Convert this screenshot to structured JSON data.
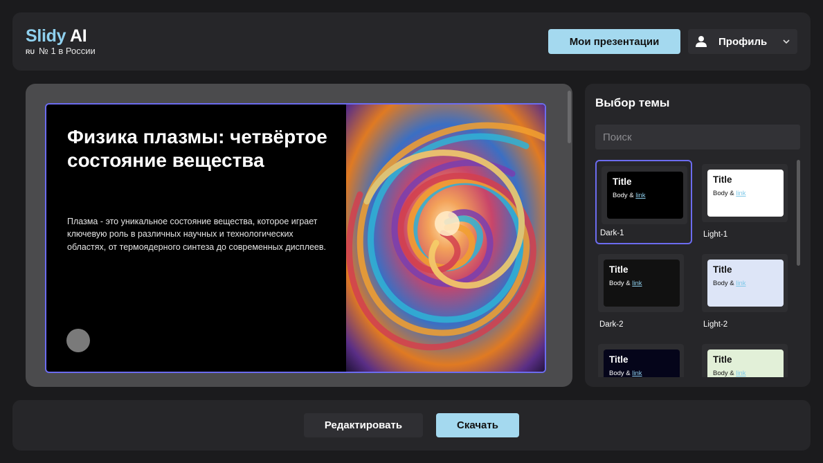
{
  "header": {
    "brand_name": "Slidy",
    "brand_suffix": "AI",
    "lang_badge": "RU",
    "tagline": "№ 1 в России",
    "my_presentations_label": "Мои презентации",
    "profile_label": "Профиль",
    "profile_icon": "user-icon",
    "dropdown_icon": "chevron-down-icon"
  },
  "slide": {
    "title": "Физика плазмы: четвёртое состояние вещества",
    "body": "Плазма - это уникальное состояние вещества, которое играет ключевую роль в различных научных и технологических областях, от термоядерного синтеза до современных дисплеев.",
    "image": "colorful-plasma-swirl-image"
  },
  "theme_panel": {
    "title": "Выбор темы",
    "search_placeholder": "Поиск",
    "themes": [
      {
        "name": "Dark-1",
        "title": "Title",
        "body": "Body &",
        "link": "link",
        "bg": "#000000",
        "fg": "#ffffff",
        "link_color": "#8fd0ee",
        "selected": true
      },
      {
        "name": "Light-1",
        "title": "Title",
        "body": "Body &",
        "link": "link",
        "bg": "#ffffff",
        "fg": "#111111",
        "link_color": "#7ec8e8",
        "selected": false
      },
      {
        "name": "Dark-2",
        "title": "Title",
        "body": "Body &",
        "link": "link",
        "bg": "#111111",
        "fg": "#ffffff",
        "link_color": "#8fd0ee",
        "selected": false
      },
      {
        "name": "Light-2",
        "title": "Title",
        "body": "Body &",
        "link": "link",
        "bg": "#dde5f7",
        "fg": "#111111",
        "link_color": "#7ec8e8",
        "selected": false
      },
      {
        "name": "",
        "title": "Title",
        "body": "Body &",
        "link": "link",
        "bg": "#05051a",
        "fg": "#ffffff",
        "link_color": "#8fd0ee",
        "selected": false
      },
      {
        "name": "",
        "title": "Title",
        "body": "Body &",
        "link": "link",
        "bg": "#e2f0d8",
        "fg": "#111111",
        "link_color": "#7ec8e8",
        "selected": false
      }
    ]
  },
  "footer": {
    "edit_label": "Редактировать",
    "download_label": "Скачать"
  },
  "colors": {
    "accent": "#a4d9ef",
    "selection": "#6c6cf0",
    "panel": "#262629",
    "background": "#1b1b1d"
  }
}
